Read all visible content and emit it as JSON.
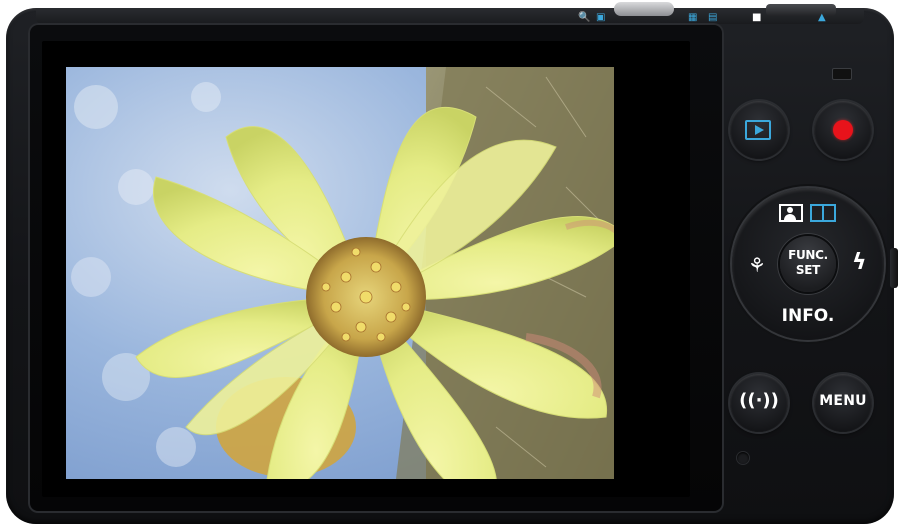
{
  "camera": {
    "dial": {
      "center_label_line1": "FUNC.",
      "center_label_line2": "SET",
      "bottom_label": "INFO.",
      "top_left_icon": "portrait-icon",
      "top_right_icon": "book-icon",
      "left_icon": "macro-icon",
      "right_icon": "flash-icon"
    },
    "buttons": {
      "playback_icon": "play-icon",
      "record_icon": "record-dot",
      "wifi_icon": "wifi-icon",
      "menu_label": "MENU"
    },
    "colors": {
      "accent_blue": "#3ba8dc",
      "record_red": "#e8131b",
      "body_black": "#141518"
    },
    "display": {
      "subject": "yellow flower"
    }
  }
}
